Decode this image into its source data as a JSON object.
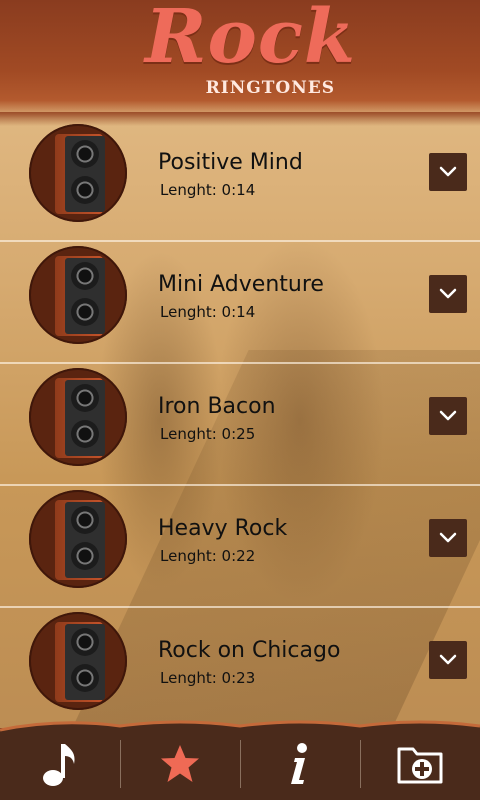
{
  "app": {
    "logo_title": "Rock",
    "logo_subtitle": "RINGTONES"
  },
  "ringtones": [
    {
      "title": "Positive Mind",
      "length": "Lenght: 0:14"
    },
    {
      "title": "Mini Adventure",
      "length": "Lenght: 0:14"
    },
    {
      "title": "Iron Bacon",
      "length": "Lenght: 0:25"
    },
    {
      "title": "Heavy Rock",
      "length": "Lenght: 0:22"
    },
    {
      "title": "Rock on Chicago",
      "length": "Lenght: 0:23"
    }
  ],
  "bottom_nav": [
    {
      "icon": "music-note-icon",
      "active": false
    },
    {
      "icon": "star-icon",
      "active": true
    },
    {
      "icon": "info-icon",
      "active": false
    },
    {
      "icon": "folder-add-icon",
      "active": false
    }
  ],
  "colors": {
    "header": "#a14a24",
    "logo": "#ee6b5a",
    "nav_bg": "#4a2a1b",
    "active_star": "#ef6a55"
  }
}
